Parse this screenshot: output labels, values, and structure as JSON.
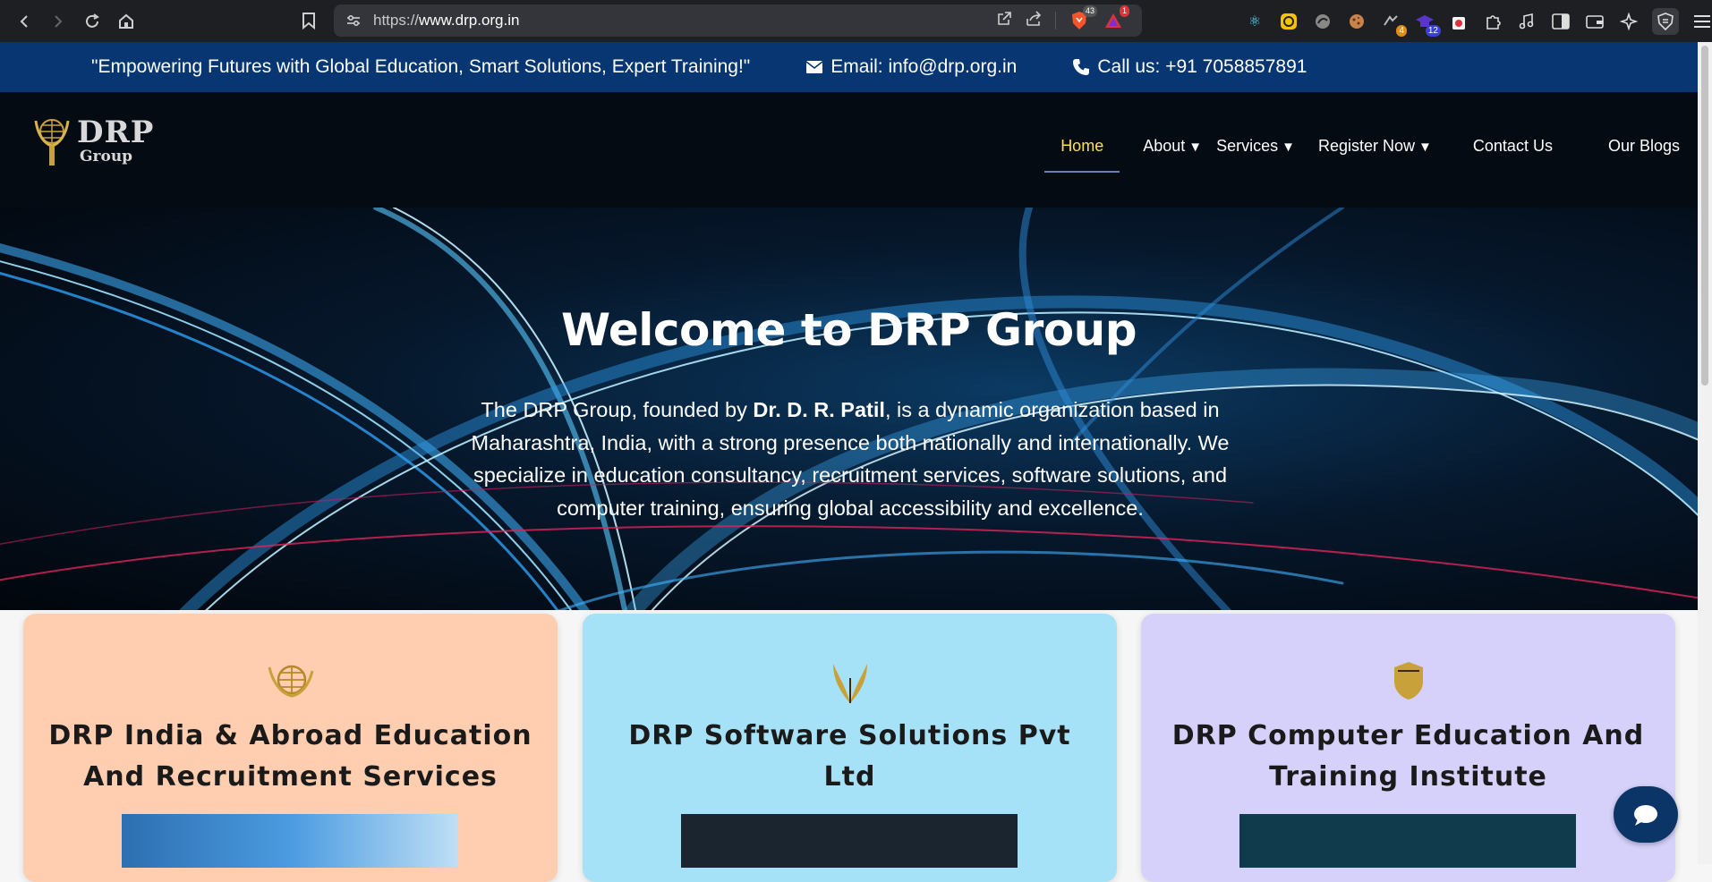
{
  "browser": {
    "url_prefix": "https://",
    "url_domain": "www.drp.org.in",
    "brave_shield_count": "43",
    "rewards_badge": "1",
    "extensions": [
      {
        "icon": "react-icon",
        "count": ""
      },
      {
        "icon": "color-picker-icon",
        "count": ""
      },
      {
        "icon": "blocker-icon",
        "count": ""
      },
      {
        "icon": "cookie-icon",
        "count": ""
      },
      {
        "icon": "extension-icon",
        "count": "4"
      },
      {
        "icon": "graduation-icon",
        "count": "12"
      },
      {
        "icon": "popcorn-icon",
        "count": ""
      },
      {
        "icon": "puzzle-icon",
        "count": ""
      },
      {
        "icon": "music-icon",
        "count": ""
      },
      {
        "icon": "sidebar-icon",
        "count": ""
      },
      {
        "icon": "wallet-icon",
        "count": ""
      },
      {
        "icon": "leo-ai-icon",
        "count": ""
      },
      {
        "icon": "vpn-icon",
        "count": ""
      },
      {
        "icon": "menu-icon",
        "count": ""
      }
    ]
  },
  "top_strip": {
    "tagline": "\"Empowering Futures with Global Education, Smart Solutions, Expert Training!\"",
    "email": "Email: info@drp.org.in",
    "phone": "Call us: +91 7058857891"
  },
  "logo": {
    "line1": "DRP",
    "line2": "Group"
  },
  "nav": {
    "home": "Home",
    "about": "About",
    "services": "Services",
    "register": "Register Now",
    "contact": "Contact Us",
    "blogs": "Our Blogs",
    "caret": "▼"
  },
  "hero": {
    "title": "Welcome to DRP Group",
    "desc_before": "The DRP Group, founded by ",
    "desc_bold": "Dr. D. R. Patil",
    "desc_after": ", is a dynamic organization based in Maharashtra, India, with a strong presence both nationally and internationally. We specialize in education consultancy, recruitment services, software solutions, and computer training, ensuring global accessibility and excellence."
  },
  "cards": [
    {
      "title": "DRP India & Abroad Education And Recruitment Services",
      "icon": "globe-emblem-icon",
      "color": "#ffcdb0"
    },
    {
      "title": "DRP Software Solutions Pvt Ltd",
      "icon": "wings-emblem-icon",
      "color": "#a6e2f7"
    },
    {
      "title": "DRP Computer Education And Training Institute",
      "icon": "shield-emblem-icon",
      "color": "#d6d1fb"
    }
  ],
  "colors": {
    "top_strip": "#073672",
    "header": "#050b13",
    "active_nav": "#ffe14d",
    "chat_button": "#0b3566"
  }
}
